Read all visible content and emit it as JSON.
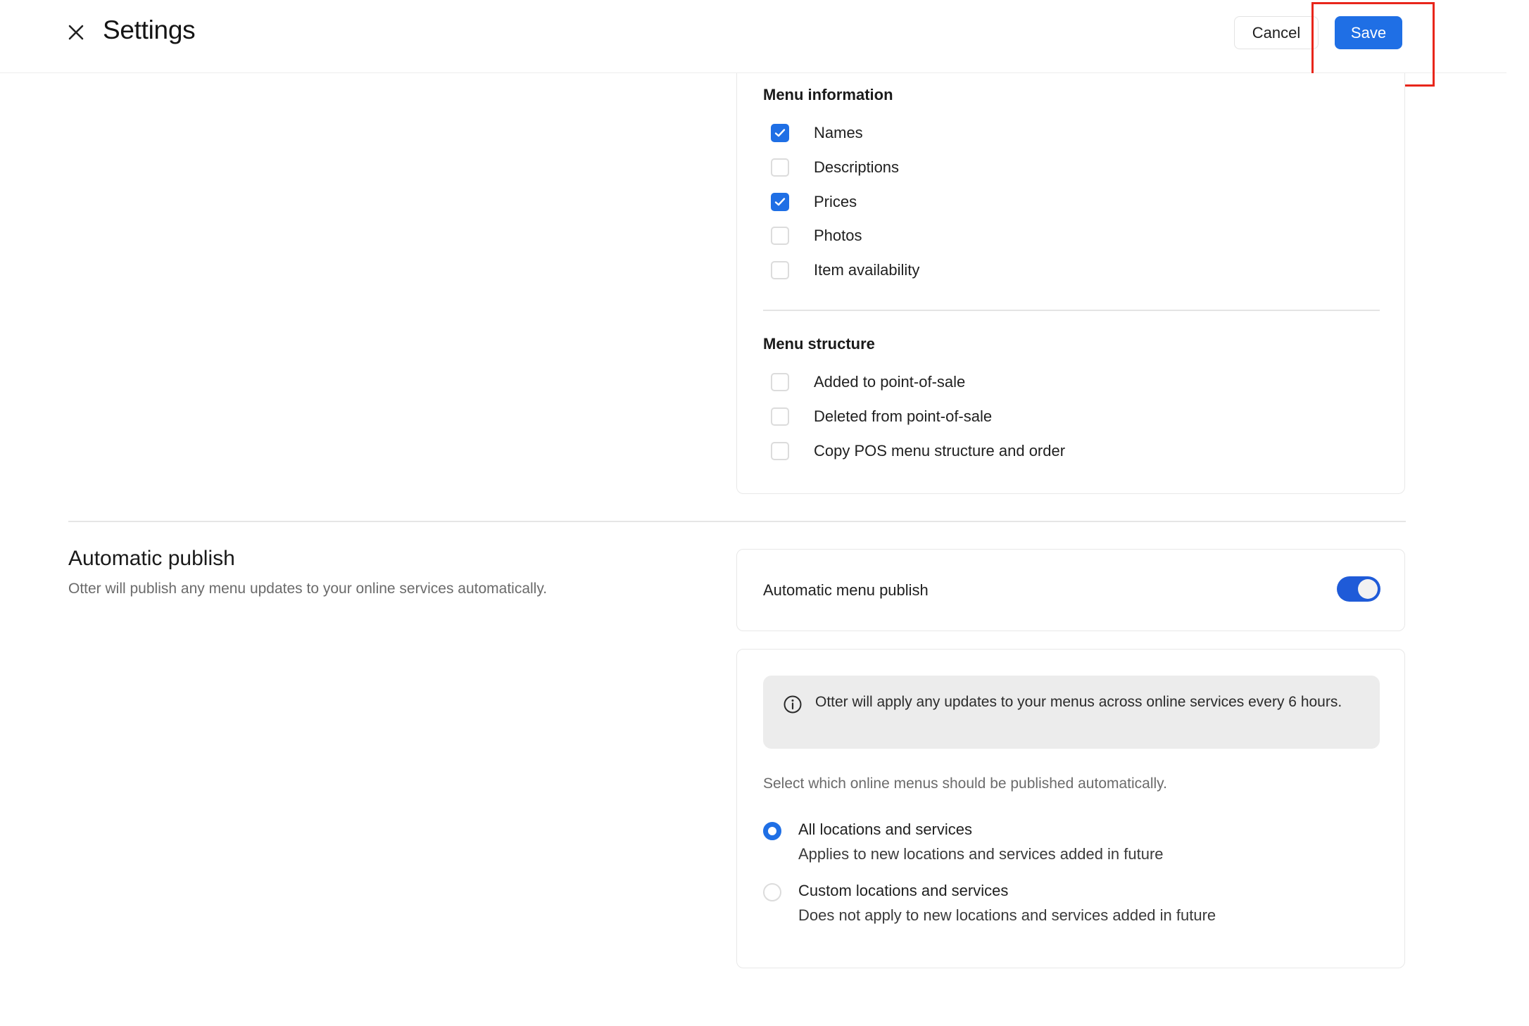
{
  "header": {
    "title": "Settings",
    "cancel_label": "Cancel",
    "save_label": "Save"
  },
  "menu_information": {
    "heading": "Menu information",
    "items": [
      {
        "label": "Names",
        "checked": true
      },
      {
        "label": "Descriptions",
        "checked": false
      },
      {
        "label": "Prices",
        "checked": true
      },
      {
        "label": "Photos",
        "checked": false
      },
      {
        "label": "Item availability",
        "checked": false
      }
    ]
  },
  "menu_structure": {
    "heading": "Menu structure",
    "items": [
      {
        "label": "Added to point-of-sale",
        "checked": false
      },
      {
        "label": "Deleted from point-of-sale",
        "checked": false
      },
      {
        "label": "Copy POS menu structure and order",
        "checked": false
      }
    ]
  },
  "automatic_publish": {
    "title": "Automatic publish",
    "description": "Otter will publish any menu updates to your online services automatically.",
    "toggle_label": "Automatic menu publish",
    "toggle_on": true,
    "info_text": "Otter will apply any updates to your menus across online services every 6 hours.",
    "select_prompt": "Select which online menus should be published automatically.",
    "options": [
      {
        "title": "All locations and services",
        "subtitle": "Applies to new locations and services added in future",
        "selected": true
      },
      {
        "title": "Custom locations and services",
        "subtitle": "Does not apply to new locations and services added in future",
        "selected": false
      }
    ]
  },
  "colors": {
    "accent": "#1f6fe5",
    "highlight": "#e8261b"
  }
}
